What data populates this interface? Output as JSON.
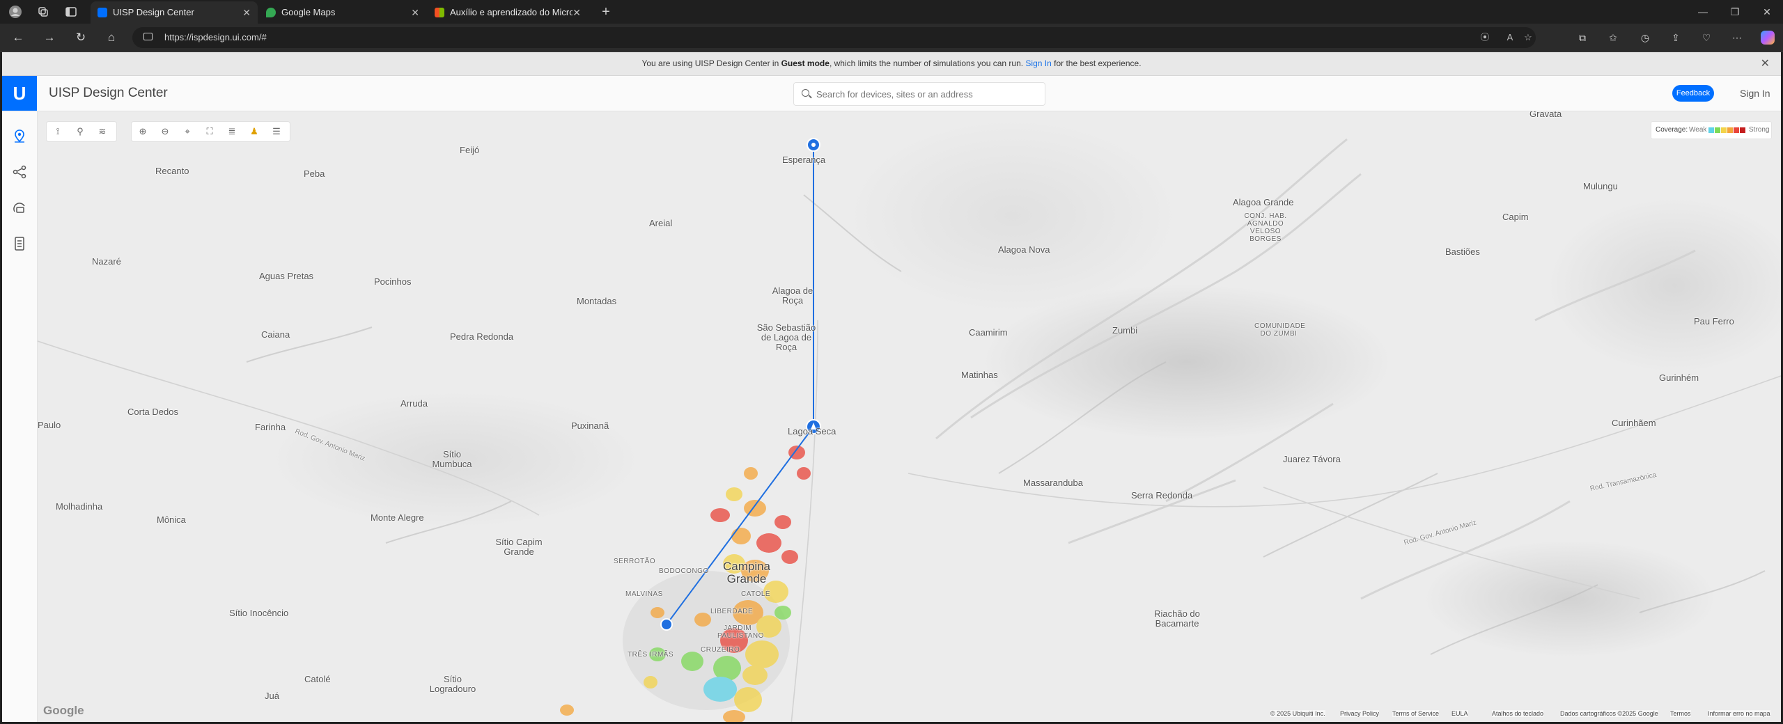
{
  "browser": {
    "tabs": [
      {
        "title": "UISP Design Center",
        "active": true,
        "favicon_color": "#006fff"
      },
      {
        "title": "Google Maps",
        "active": false,
        "favicon_color": "#34a853"
      },
      {
        "title": "Auxílio e aprendizado do Microsoft",
        "active": false,
        "favicon_color": "#f25022"
      }
    ],
    "new_tab_symbol": "+",
    "url": "https://ispdesign.ui.com/#"
  },
  "banner": {
    "prefix": "You are using UISP Design Center in",
    "mode": "Guest mode",
    "middle": ", which limits the number of simulations you can run.",
    "link": "Sign In",
    "suffix": "for the best experience."
  },
  "header": {
    "logo_letter": "U",
    "title": "UISP Design Center",
    "search_placeholder": "Search for devices, sites or an address",
    "feedback_label": "Feedback",
    "signin_label": "Sign In"
  },
  "sidebar": {
    "items": [
      {
        "name": "sites-icon",
        "active": true
      },
      {
        "name": "topology-icon",
        "active": false
      },
      {
        "name": "devices-icon",
        "active": false
      },
      {
        "name": "bill-of-materials-icon",
        "active": false
      }
    ]
  },
  "map_toolbar": {
    "group1": [
      "add-link-icon",
      "add-site-icon",
      "filter-icon"
    ],
    "group2": [
      "zoom-in-icon",
      "zoom-out-icon",
      "locate-icon",
      "fullscreen-icon",
      "layers-icon",
      "street-view-icon",
      "menu-icon"
    ]
  },
  "coverage": {
    "label": "Coverage:",
    "weak": "Weak",
    "strong": "Strong",
    "colors": [
      "#5fd3e8",
      "#7ed957",
      "#f3d34a",
      "#f4a53a",
      "#e8453a",
      "#c41e1e"
    ]
  },
  "places": [
    {
      "text": "Feijó"
    },
    {
      "text": "Recanto"
    },
    {
      "text": "Peba"
    },
    {
      "text": "Esperança"
    },
    {
      "text": "Areial"
    },
    {
      "text": "Nazaré"
    },
    {
      "text": "Aguas Pretas"
    },
    {
      "text": "Pocinhos"
    },
    {
      "text": "Montadas"
    },
    {
      "text": "Alagoa de Roça"
    },
    {
      "text": "Caiana"
    },
    {
      "text": "Pedra Redonda"
    },
    {
      "text": "São Sebastião de Lagoa de Roça"
    },
    {
      "text": "Arruda"
    },
    {
      "text": "Corta Dedos"
    },
    {
      "text": "Puxinanã"
    },
    {
      "text": "Farinha"
    },
    {
      "text": "Rod. Gov. Antonio Mariz"
    },
    {
      "text": "Sítio Mumbuca"
    },
    {
      "text": "Lagoa Seca"
    },
    {
      "text": "Paulo"
    },
    {
      "text": "Molhadinha"
    },
    {
      "text": "Mônica"
    },
    {
      "text": "Monte Alegre"
    },
    {
      "text": "Sítio Capim Grande"
    },
    {
      "text": "SERROTÃO"
    },
    {
      "text": "BODOCONGO"
    },
    {
      "text": "Campina Grande"
    },
    {
      "text": "MALVINAS"
    },
    {
      "text": "CATOLÉ"
    },
    {
      "text": "LIBERDADE"
    },
    {
      "text": "JARDIM PAULISTANO"
    },
    {
      "text": "CRUZEIRO"
    },
    {
      "text": "TRÊS IRMÃS"
    },
    {
      "text": "Sítio Inocêncio"
    },
    {
      "text": "Catolé"
    },
    {
      "text": "Sítio Logradouro"
    },
    {
      "text": "Juá"
    },
    {
      "text": "Gravatá"
    },
    {
      "text": "Alagoa Grande"
    },
    {
      "text": "CONJ. HAB. AGNALDO VELOSO BORGES"
    },
    {
      "text": "Mulungu"
    },
    {
      "text": "Capim"
    },
    {
      "text": "Bastiões"
    },
    {
      "text": "Alagoa Nova"
    },
    {
      "text": "Caamirim"
    },
    {
      "text": "Zumbi"
    },
    {
      "text": "COMUNIDADE DO ZUMBI"
    },
    {
      "text": "Pau Ferro"
    },
    {
      "text": "Matinhas"
    },
    {
      "text": "Gurinhém"
    },
    {
      "text": "Curinhãem"
    },
    {
      "text": "Juarez Távora"
    },
    {
      "text": "Massaranduba"
    },
    {
      "text": "Serra Redonda"
    },
    {
      "text": "Rod. Transamazônica"
    },
    {
      "text": "Rod. Gov. Antonio Mariz"
    },
    {
      "text": "Riachão do Bacamarte"
    }
  ],
  "attribution": {
    "copyright": "© 2025 Ubiquiti Inc.",
    "privacy": "Privacy Policy",
    "terms_service": "Terms of Service",
    "eula": "EULA",
    "shortcuts": "Atalhos do teclado",
    "map_data": "Dados cartográficos ©2025 Google",
    "terms": "Termos",
    "report": "Informar erro no mapa",
    "google": "Google"
  }
}
